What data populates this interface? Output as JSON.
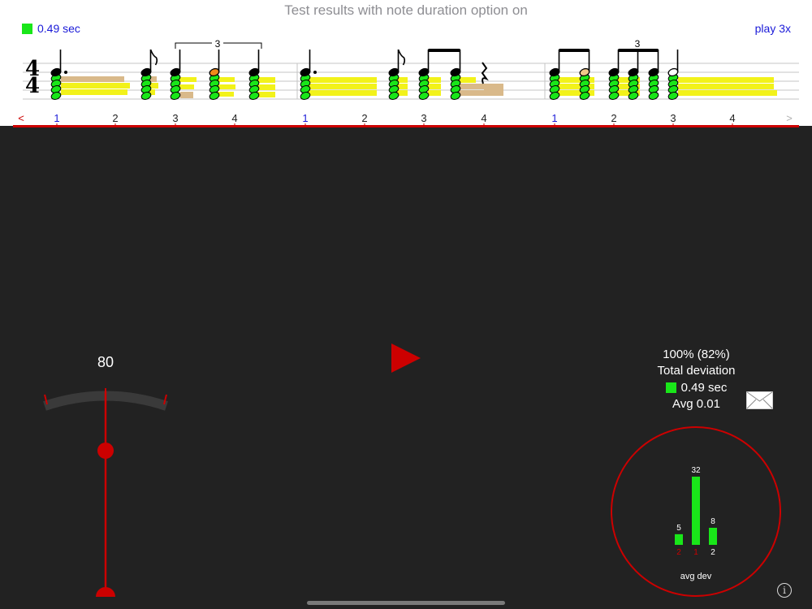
{
  "title": "Test results with note duration option on",
  "deviation": {
    "value": "0.49 sec",
    "color": "#19e619"
  },
  "play_repeat_label": "play 3x",
  "time_signature": {
    "top": "4",
    "bottom": "4"
  },
  "tuplet_label": "3",
  "beats": [
    "1",
    "2",
    "3",
    "4",
    "1",
    "2",
    "3",
    "4",
    "1",
    "2",
    "3",
    "4"
  ],
  "nav": {
    "prev": "<",
    "next": ">"
  },
  "tempo": "80",
  "results": {
    "percent": "100%  (82%)",
    "total_label": "Total deviation",
    "total_value": "0.49 sec",
    "avg": "Avg 0.01"
  },
  "colors": {
    "accent": "#cc0000",
    "good": "#19e619",
    "highlight": "#f2f21a",
    "duration": "#d9b98a"
  },
  "chart_data": {
    "type": "bar",
    "categories": [
      "2",
      "1",
      "2"
    ],
    "values": [
      5,
      32,
      8
    ],
    "xlabel": "avg dev",
    "category_colors": [
      "#cc0000",
      "#cc0000",
      "#ffffff"
    ]
  },
  "icons": {
    "play": "play-icon",
    "mail": "mail-icon",
    "info": "info-icon",
    "prev": "chevron-left-icon",
    "next": "chevron-right-icon"
  }
}
